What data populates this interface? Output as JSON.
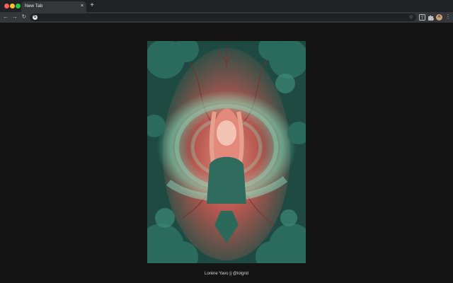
{
  "browser": {
    "tab": {
      "title": "New Tab",
      "close_icon": "×"
    },
    "new_tab_icon": "+",
    "toolbar": {
      "back_icon": "←",
      "forward_icon": "→",
      "reload_icon": "↻",
      "address": {
        "value": "",
        "placeholder": ""
      },
      "bookmark_icon": "☆",
      "avatar_letter": "A",
      "menu_icon": "⋮"
    }
  },
  "content": {
    "caption": "Lorène Yavo || @lolgrid"
  },
  "colors": {
    "background": "#141414",
    "tabstrip": "#202124",
    "toolbar": "#35363a",
    "teal": "#2f6b5c",
    "mint_glow": "#7fe6c0",
    "coral": "#c9685f"
  }
}
